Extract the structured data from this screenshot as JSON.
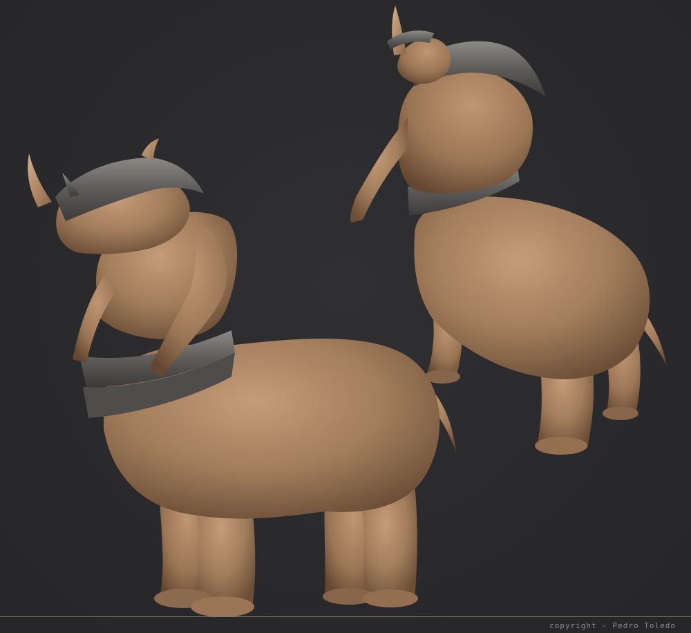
{
  "footer": {
    "copyright_text": "copyright - Pedro Toledo"
  },
  "colors": {
    "background": "#2a2a2c",
    "clay_skin": "#a27d5c",
    "clay_highlight": "#c49c78",
    "clay_shadow": "#6b4e36",
    "armor_metal": "#5d5c5a",
    "armor_highlight": "#8b8a86",
    "footer_rule": "#8a7a5e",
    "footer_text": "#8d8c88"
  },
  "figures": [
    {
      "view": "front-three-quarter"
    },
    {
      "view": "back-three-quarter"
    }
  ]
}
